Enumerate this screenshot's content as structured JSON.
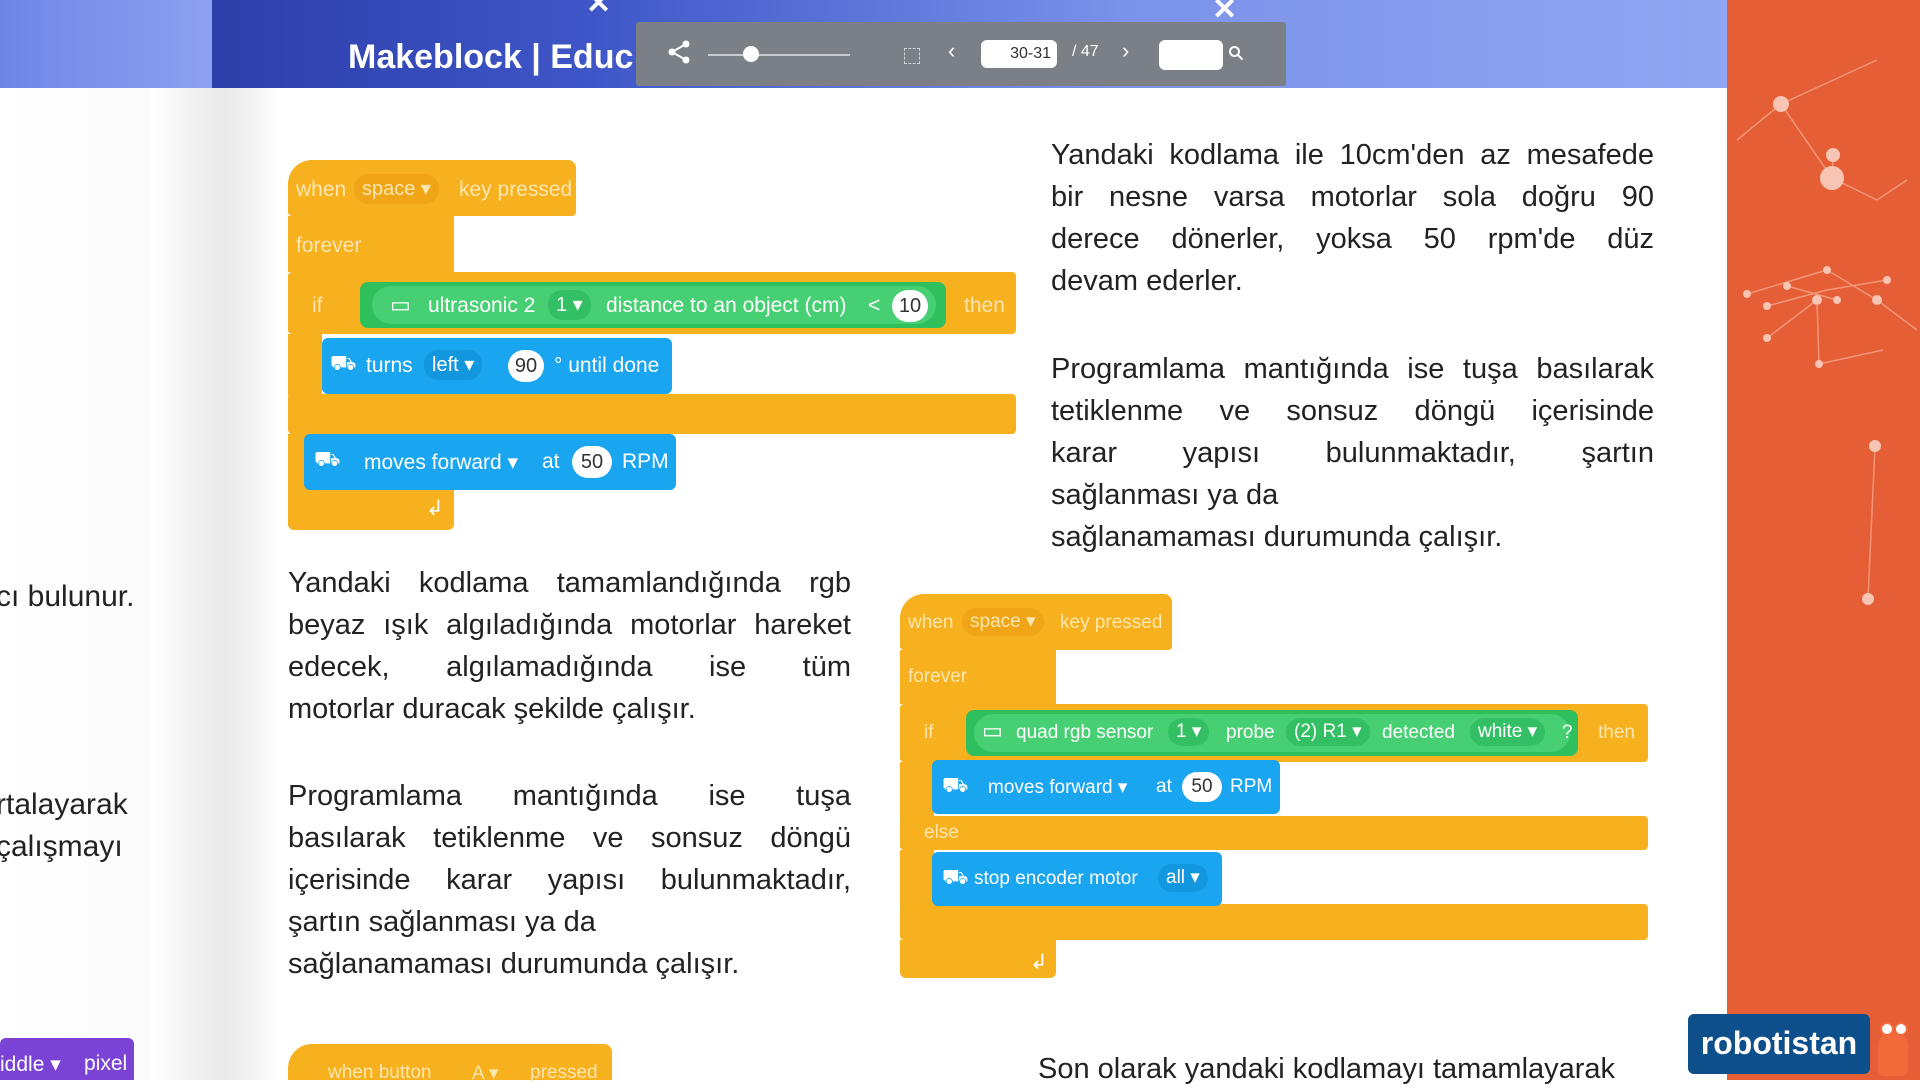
{
  "header": {
    "title": "Makeblock | Educ"
  },
  "toolbar": {
    "page_value": "30-31",
    "page_total": "/ 47",
    "zoom_percent": 30,
    "search_value": ""
  },
  "left_page": {
    "lines": [
      "cı bulunur.",
      "rtalayarak",
      "çalışmayı"
    ],
    "blocks": {
      "middle": "iddle ▾",
      "pixel": "pixel"
    }
  },
  "right_text": {
    "para1": [
      "Yandaki kodlama ile 10cm'den az mesafede",
      "bir nesne varsa motorlar sola doğru 90",
      "derece dönerler, yoksa 50 rpm'de düz",
      "devam ederler."
    ],
    "para2": [
      "Programlama mantığında ise tuşa basılarak",
      "tetiklenme ve sonsuz döngü içerisinde",
      "karar yapısı bulunmaktadır, şartın",
      "sağlanması ya da",
      "sağlanamaması durumunda çalışır."
    ],
    "para3": [
      "Son olarak yandaki kodlamayı tamamlayarak"
    ]
  },
  "left_text": {
    "para1": [
      "Yandaki kodlama tamamlandığında rgb",
      "beyaz ışık algıladığında motorlar hareket",
      "edecek, algılamadığında ise tüm",
      "motorlar duracak şekilde çalışır."
    ],
    "para2": [
      "Programlama mantığında ise tuşa",
      "basılarak tetiklenme ve sonsuz döngü",
      "içerisinde karar yapısı bulunmaktadır,",
      "şartın sağlanması ya da",
      "sağlanamaması durumunda çalışır."
    ]
  },
  "code1": {
    "when": "when",
    "key": "space ▾",
    "key_pressed": "key pressed",
    "forever": "forever",
    "if": "if",
    "sensor": "ultrasonic 2",
    "port": "1 ▾",
    "measure": "distance to an object (cm)",
    "lt": "<",
    "threshold": "10",
    "then": "then",
    "turns": "turns",
    "dir": "left ▾",
    "angle": "90",
    "until_done": "° until done",
    "moves": "moves forward ▾",
    "at": "at",
    "rpm_value": "50",
    "rpm": "RPM"
  },
  "code2": {
    "when": "when",
    "key": "space ▾",
    "key_pressed": "key pressed",
    "forever": "forever",
    "if": "if",
    "sensor": "quad rgb sensor",
    "port": "1 ▾",
    "probe": "probe",
    "probe_val": "(2) R1 ▾",
    "detected": "detected",
    "color": "white ▾",
    "q": "?",
    "then": "then",
    "moves": "moves forward ▾",
    "at": "at",
    "rpm_value": "50",
    "rpm": "RPM",
    "else": "else",
    "stop": "stop encoder motor",
    "all": "all ▾"
  },
  "code3": {
    "when_button": "when button",
    "btn": "A ▾",
    "pressed": "pressed"
  },
  "brand": {
    "logo": "robotistan"
  }
}
